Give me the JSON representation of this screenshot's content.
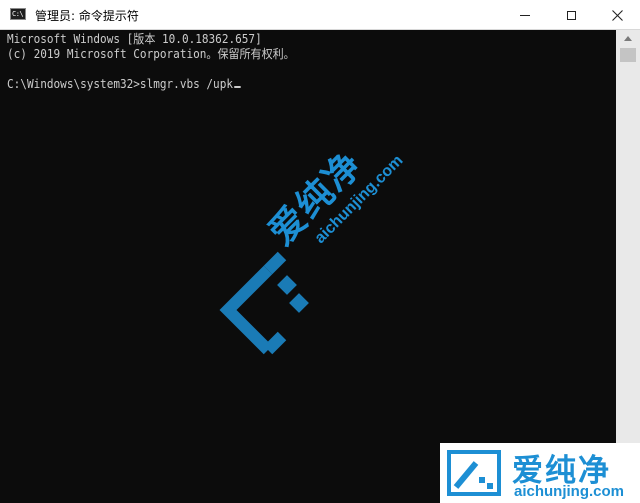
{
  "window": {
    "title": "管理员: 命令提示符",
    "app_icon_text": "C:\\"
  },
  "console": {
    "lines": [
      "Microsoft Windows [版本 10.0.18362.657]",
      "(c) 2019 Microsoft Corporation。保留所有权利。",
      "",
      "C:\\Windows\\system32>slmgr.vbs /upk"
    ]
  },
  "watermark": {
    "center_brand": "爱纯净",
    "center_url": "aichunjing.com",
    "box_brand": "爱纯净",
    "box_url": "aichunjing.com",
    "color": "#1d8fd4"
  },
  "colors": {
    "console_bg": "#0c0c0c",
    "console_fg": "#cccccc",
    "titlebar_bg": "#ffffff"
  },
  "icons": {
    "app": "cmd-icon",
    "minimize": "minimize-icon",
    "maximize": "maximize-icon",
    "close": "close-icon"
  }
}
